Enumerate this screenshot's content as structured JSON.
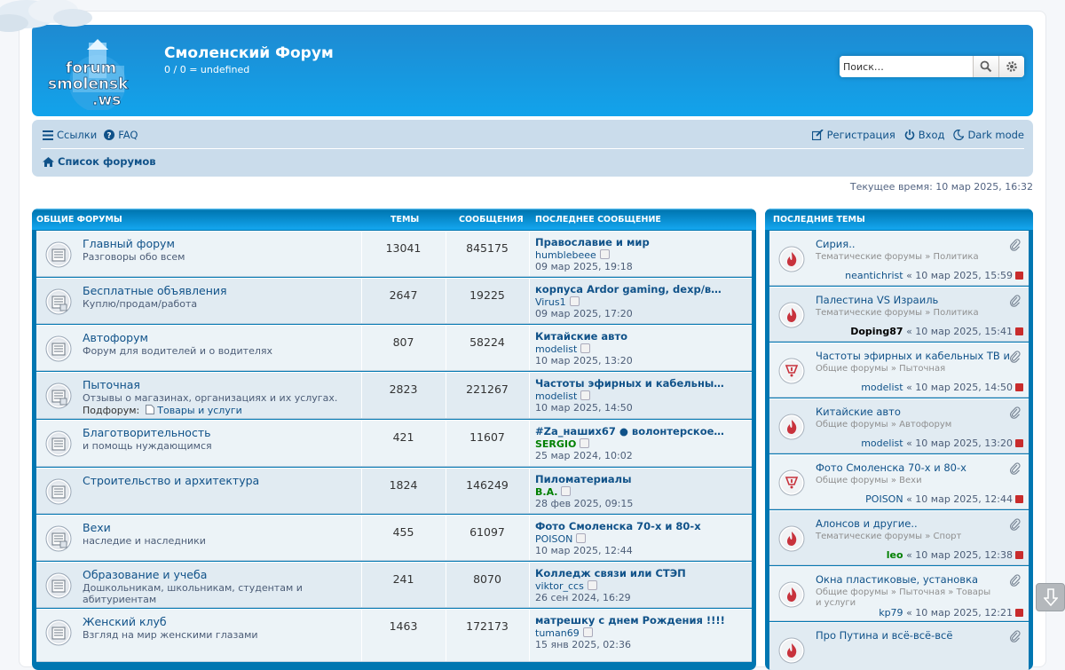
{
  "header": {
    "title": "Смоленский Форум",
    "subtitle": "0 / 0 = undefined",
    "logo_text": [
      "forum",
      "smolensk",
      ".ws"
    ],
    "search_placeholder": "Поиск…"
  },
  "nav": {
    "links_label": "Ссылки",
    "faq_label": "FAQ",
    "register_label": "Регистрация",
    "login_label": "Вход",
    "darkmode_label": "Dark mode",
    "breadcrumb": "Список форумов"
  },
  "current_time": "Текущее время: 10 мар 2025, 16:32",
  "forums_table": {
    "headers": {
      "section": "ОБЩИЕ ФОРУМЫ",
      "topics": "ТЕМЫ",
      "posts": "СООБЩЕНИЯ",
      "last": "ПОСЛЕДНЕЕ СООБЩЕНИЕ"
    },
    "rows": [
      {
        "title": "Главный форум",
        "desc": "Разговоры обо всем",
        "topics": "13041",
        "posts": "845175",
        "last_title": "Православие и мир",
        "last_user": "humblebeee",
        "last_date": "09 мар 2025, 19:18"
      },
      {
        "title": "Бесплатные объявления",
        "desc": "Куплю/продам/работа",
        "topics": "2647",
        "posts": "19225",
        "last_title": "корпуса Ardor gaming, dexp/ве…",
        "last_user": "Virus1",
        "last_date": "09 мар 2025, 17:20"
      },
      {
        "title": "Автофорум",
        "desc": "Форум для водителей и о водителях",
        "topics": "807",
        "posts": "58224",
        "last_title": "Китайские авто",
        "last_user": "modelist",
        "last_date": "10 мар 2025, 13:20"
      },
      {
        "title": "Пыточная",
        "desc": "Отзывы о магазинах, организациях и их услугах.",
        "sub_label": "Подфорум:",
        "sub_link": "Товары и услуги",
        "topics": "2823",
        "posts": "221267",
        "last_title": "Частоты эфирных и кабельных Т…",
        "last_user": "modelist",
        "last_date": "10 мар 2025, 14:50"
      },
      {
        "title": "Благотворительность",
        "desc": "и помощь нуждающимся",
        "topics": "421",
        "posts": "11607",
        "last_title": "#Za_наших67 ● волонтерское дв…",
        "last_user": "SERGIO",
        "last_date": "25 мар 2024, 10:02"
      },
      {
        "title": "Строительство и архитектура",
        "desc": "",
        "topics": "1824",
        "posts": "146249",
        "last_title": "Пиломатериалы",
        "last_user": "B.A.",
        "last_date": "28 фев 2025, 09:15"
      },
      {
        "title": "Вехи",
        "desc": "наследие и наследники",
        "topics": "455",
        "posts": "61097",
        "last_title": "Фото Смоленска 70-х и 80-х",
        "last_user": "POISON",
        "last_date": "10 мар 2025, 12:44"
      },
      {
        "title": "Образование и учеба",
        "desc": "Дошкольникам, школьникам, студентам и абитуриентам",
        "topics": "241",
        "posts": "8070",
        "last_title": "Колледж связи или СТЭП",
        "last_user": "viktor_ccs",
        "last_date": "26 сен 2024, 16:29"
      },
      {
        "title": "Женский клуб",
        "desc": "Взгляд на мир женскими глазами",
        "topics": "1463",
        "posts": "172173",
        "last_title": "матрешку с днем Рождения !!!!",
        "last_user": "tuman69",
        "last_date": "15 янв 2025, 02:36"
      }
    ]
  },
  "recent": {
    "header": "ПОСЛЕДНИЕ ТЕМЫ",
    "items": [
      {
        "title": "Сирия..",
        "path1": "Тематические форумы",
        "path2": "Политика",
        "path3": "",
        "user": "neantichrist",
        "date": "« 10 мар 2025, 15:59"
      },
      {
        "title": "Палестина VS Израиль",
        "path1": "Тематические форумы",
        "path2": "Политика",
        "path3": "",
        "user": "Doping87",
        "date": "« 10 мар 2025, 15:41"
      },
      {
        "title": "Частоты эфирных и кабельных ТВ и р…",
        "path1": "Общие форумы",
        "path2": "Пыточная",
        "path3": "",
        "user": "modelist",
        "date": "« 10 мар 2025, 14:50"
      },
      {
        "title": "Китайские авто",
        "path1": "Общие форумы",
        "path2": "Автофорум",
        "path3": "",
        "user": "modelist",
        "date": "« 10 мар 2025, 13:20"
      },
      {
        "title": "Фото Смоленска 70-х и 80-х",
        "path1": "Общие форумы",
        "path2": "Вехи",
        "path3": "",
        "user": "POISON",
        "date": "« 10 мар 2025, 12:44"
      },
      {
        "title": "Алонсов и другие..",
        "path1": "Тематические форумы",
        "path2": "Спорт",
        "path3": "",
        "user": "leo",
        "date": "« 10 мар 2025, 12:38"
      },
      {
        "title": "Окна пластиковые, установка",
        "path1": "Общие форумы",
        "path2": "Пыточная",
        "path3": "Товары и услуги",
        "user": "kp79",
        "date": "« 10 мар 2025, 12:21"
      },
      {
        "title": "Про Путина и всё-всё-всё",
        "path1": "",
        "path2": "",
        "path3": "",
        "user": "",
        "date": ""
      }
    ]
  },
  "colors": {
    "accent": "#12a3eb",
    "link": "#105289",
    "sergio": "#008000",
    "doping": "#000000",
    "leo": "#008000"
  }
}
